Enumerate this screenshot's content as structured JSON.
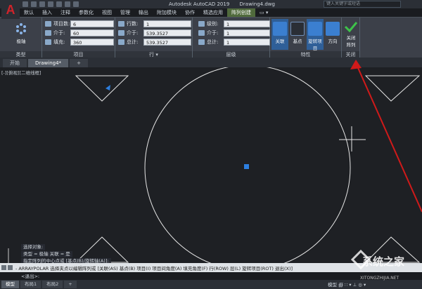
{
  "window": {
    "app_name": "Autodesk AutoCAD 2019",
    "file_name": "Drawing4.dwg",
    "search_placeholder": "键入关键字或短语"
  },
  "ribbon_tabs": [
    "默认",
    "插入",
    "注释",
    "参数化",
    "视图",
    "管理",
    "输出",
    "附加模块",
    "协作",
    "精选应用",
    "阵列创建",
    "▭ ▾"
  ],
  "ribbon": {
    "type_group": {
      "button_label": "极轴",
      "group_label": "类型"
    },
    "items_group": {
      "label": "项目",
      "rows": [
        {
          "label": "项目数:",
          "value": "6"
        },
        {
          "label": "介于:",
          "value": "60"
        },
        {
          "label": "填充:",
          "value": "360"
        }
      ]
    },
    "rows_group": {
      "label": "行 ▾",
      "rows": [
        {
          "label": "行数:",
          "value": "1"
        },
        {
          "label": "介于:",
          "value": "539.3527"
        },
        {
          "label": "总计:",
          "value": "539.3527"
        }
      ]
    },
    "levels_group": {
      "label": "层级",
      "rows": [
        {
          "label": "级别:",
          "value": "1"
        },
        {
          "label": "介于:",
          "value": "1"
        },
        {
          "label": "总计:",
          "value": "1"
        }
      ]
    },
    "properties_group": {
      "label": "特性",
      "buttons": [
        "关联",
        "基点",
        "旋转项目",
        "方向"
      ]
    },
    "close_group": {
      "label": "关闭",
      "button_line1": "关闭",
      "button_line2": "阵列"
    }
  },
  "doc_tabs": [
    "开始",
    "Drawing4*",
    "+"
  ],
  "viewport_label": "[-][俯视][二维线框]",
  "command": {
    "history": [
      "选择对象:",
      "类型 = 极轴  关联 = 是",
      "指定阵列的中心点或 [基点(B)/旋转轴(A)]:"
    ],
    "prompt": "- ARRAYPOLAR 选择夹点以编辑阵列或 [关联(AS) 基点(B) 项目(I) 项目间角度(A) 填充角度(F) 行(ROW) 层(L) 旋转项目(ROT) 退出(X)]",
    "input": "<退出>:"
  },
  "status_tabs": [
    "模型",
    "布局1",
    "布局2",
    "+"
  ],
  "status_model": "模型 ∰ ∷ ▾ ⊥ ◎ ▾",
  "watermark": {
    "text": "系统之家",
    "url": "XITONGZHIJIA.NET"
  },
  "colors": {
    "accent_red": "#d0232a",
    "grip_blue": "#2d7fe0",
    "arrow_red": "#d01a1a"
  }
}
